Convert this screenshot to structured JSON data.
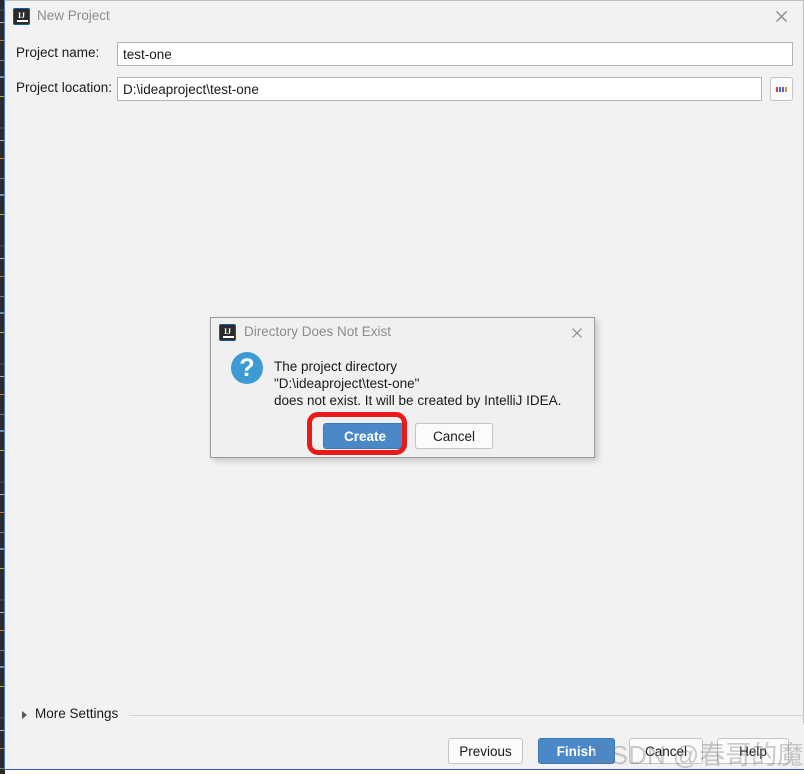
{
  "window": {
    "title": "New Project",
    "app_icon": "intellij-idea-icon",
    "close_icon": "close-icon"
  },
  "form": {
    "fields": [
      {
        "label": "Project name:",
        "value": "test-one",
        "placeholder": ""
      },
      {
        "label": "Project location:",
        "value": "D:\\ideaproject\\test-one",
        "placeholder": ""
      }
    ],
    "browse_button": {
      "icon": "browse-ellipsis-icon",
      "label": "..."
    }
  },
  "more_settings": {
    "label": "More Settings",
    "arrow_icon": "chevron-right-icon",
    "expanded": false
  },
  "footer": {
    "buttons": [
      {
        "label": "Previous",
        "style": "default"
      },
      {
        "label": "Finish",
        "style": "primary"
      },
      {
        "label": "Cancel",
        "style": "default"
      },
      {
        "label": "Help",
        "style": "default"
      }
    ]
  },
  "watermark": {
    "text": "CSDN @春哥的魔法书"
  },
  "dialog": {
    "title": "Directory Does Not Exist",
    "icon": "question-mark-icon",
    "app_icon": "intellij-idea-icon",
    "close_icon": "close-icon",
    "message": "The project directory\n\"D:\\ideaproject\\test-one\"\ndoes not exist. It will be created by IntelliJ IDEA.",
    "buttons": [
      {
        "label": "Create",
        "style": "primary"
      },
      {
        "label": "Cancel",
        "style": "default"
      }
    ]
  },
  "annotation": {
    "highlight_color": "#e81b1b",
    "target": "Create"
  },
  "colors": {
    "window_bg": "#f2f2f2",
    "dialog_bg": "#f0f0f0",
    "primary_button": "#4a88c7",
    "accent_blue": "#3d9bd4",
    "title_text": "#8c8c8c",
    "body_text": "#1a1a1a"
  }
}
